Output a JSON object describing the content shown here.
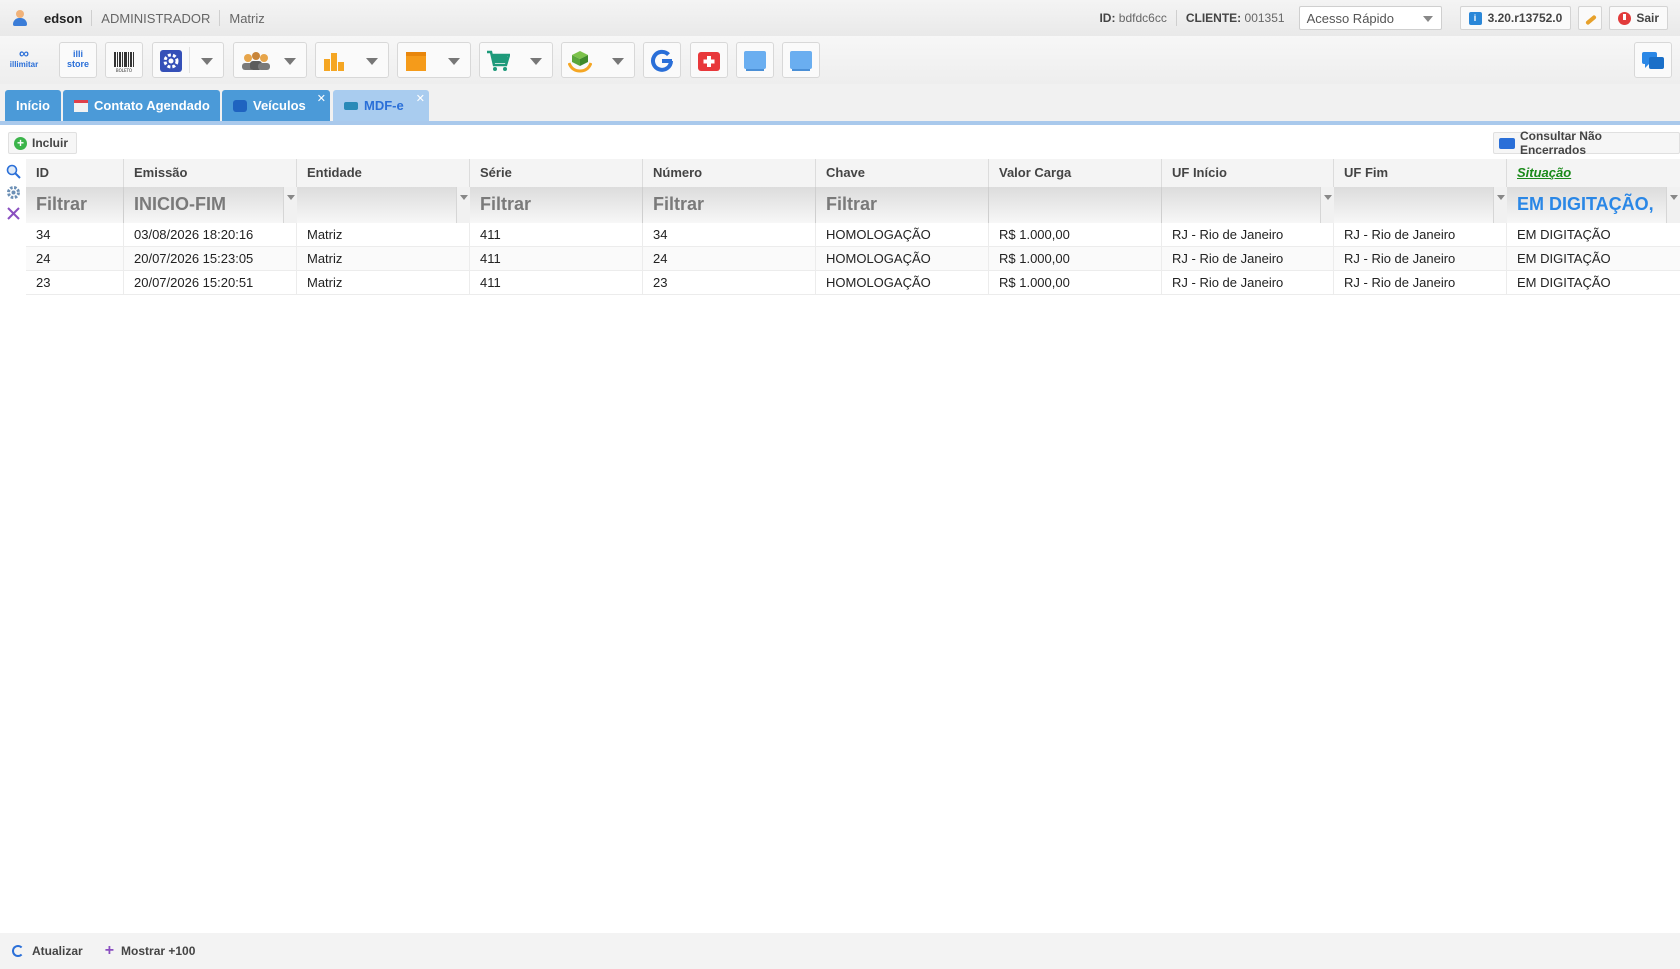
{
  "topbar": {
    "username": "edson",
    "role": "ADMINISTRADOR",
    "branch": "Matriz",
    "id_label": "ID:",
    "id_value": "bdfdc6cc",
    "client_label": "CLIENTE:",
    "client_value": "001351",
    "quick_access": "Acesso Rápido",
    "version": "3.20.r13752.0",
    "logout": "Sair"
  },
  "toolbar": {
    "icons": [
      "illimitar-logo",
      "illi-store",
      "barcode-boleto",
      "settings",
      "people",
      "bar-chart",
      "box",
      "cart",
      "hands-box",
      "google",
      "first-aid",
      "screen-blue",
      "screen-blue-2",
      "chat"
    ],
    "illimitar_label": "illimitar",
    "store_label": "illi\nstore",
    "boleto_label": "BOLETO"
  },
  "tabs": [
    {
      "label": "Início",
      "closable": false
    },
    {
      "label": "Contato Agendado",
      "closable": false
    },
    {
      "label": "Veículos",
      "closable": true
    },
    {
      "label": "MDF-e",
      "closable": true,
      "active": true
    }
  ],
  "actions": {
    "include": "Incluir",
    "consult": "Consultar Não Encerrados"
  },
  "grid": {
    "columns": [
      "ID",
      "Emissão",
      "Entidade",
      "Série",
      "Número",
      "Chave",
      "Valor Carga",
      "UF Início",
      "UF Fim",
      "Situação"
    ],
    "filters": [
      "Filtrar",
      "INICIO-FIM",
      "",
      "Filtrar",
      "Filtrar",
      "Filtrar",
      "",
      "",
      "",
      "EM DIGITAÇÃO,"
    ],
    "rows": [
      [
        "34",
        "03/08/2026 18:20:16",
        "Matriz",
        "411",
        "34",
        "HOMOLOGAÇÃO",
        "R$ 1.000,00",
        "RJ - Rio de Janeiro",
        "RJ - Rio de Janeiro",
        "EM DIGITAÇÃO"
      ],
      [
        "24",
        "20/07/2026 15:23:05",
        "Matriz",
        "411",
        "24",
        "HOMOLOGAÇÃO",
        "R$ 1.000,00",
        "RJ - Rio de Janeiro",
        "RJ - Rio de Janeiro",
        "EM DIGITAÇÃO"
      ],
      [
        "23",
        "20/07/2026 15:20:51",
        "Matriz",
        "411",
        "23",
        "HOMOLOGAÇÃO",
        "R$ 1.000,00",
        "RJ - Rio de Janeiro",
        "RJ - Rio de Janeiro",
        "EM DIGITAÇÃO"
      ]
    ]
  },
  "footer": {
    "refresh": "Atualizar",
    "show_more": "Mostrar +100"
  },
  "colors": {
    "tab_blue": "#4b9ad8",
    "tab_active": "#a9ccef",
    "situacao_green": "#1a8a1a",
    "filter_blue": "#2a87e6"
  }
}
